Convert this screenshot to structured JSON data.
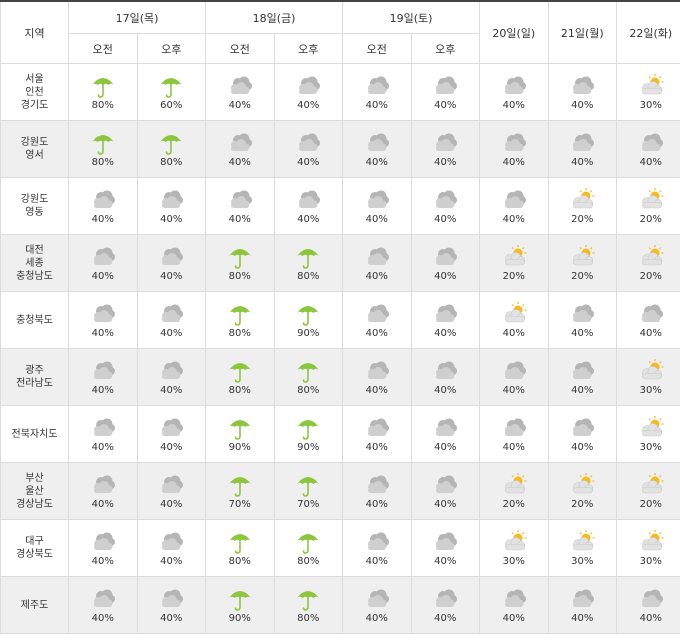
{
  "header": {
    "region_label": "지역",
    "days": [
      {
        "label": "17일(목)",
        "split": true
      },
      {
        "label": "18일(금)",
        "split": true
      },
      {
        "label": "19일(토)",
        "split": true
      },
      {
        "label": "20일(일)",
        "split": false
      },
      {
        "label": "21일(월)",
        "split": false
      },
      {
        "label": "22일(화)",
        "split": false
      }
    ],
    "am_label": "오전",
    "pm_label": "오후"
  },
  "icons": {
    "rain": "umbrella-icon",
    "cloudy": "cloudy-icon",
    "partly": "partly-cloudy-icon"
  },
  "colors": {
    "umbrella": "#8cc63f",
    "cloud": "#b5b5b5",
    "sun": "#f5b921",
    "row_shade": "#efefef",
    "border": "#dcdcdc"
  },
  "rows": [
    {
      "region": [
        "서울",
        "인천",
        "경기도"
      ],
      "cells": [
        {
          "icon": "rain",
          "pct": "80%"
        },
        {
          "icon": "rain",
          "pct": "60%"
        },
        {
          "icon": "cloudy",
          "pct": "40%"
        },
        {
          "icon": "cloudy",
          "pct": "40%"
        },
        {
          "icon": "cloudy",
          "pct": "40%"
        },
        {
          "icon": "cloudy",
          "pct": "40%"
        },
        {
          "icon": "cloudy",
          "pct": "40%"
        },
        {
          "icon": "cloudy",
          "pct": "40%"
        },
        {
          "icon": "partly",
          "pct": "30%"
        }
      ]
    },
    {
      "region": [
        "강원도",
        "영서"
      ],
      "cells": [
        {
          "icon": "rain",
          "pct": "80%"
        },
        {
          "icon": "rain",
          "pct": "80%"
        },
        {
          "icon": "cloudy",
          "pct": "40%"
        },
        {
          "icon": "cloudy",
          "pct": "40%"
        },
        {
          "icon": "cloudy",
          "pct": "40%"
        },
        {
          "icon": "cloudy",
          "pct": "40%"
        },
        {
          "icon": "cloudy",
          "pct": "40%"
        },
        {
          "icon": "cloudy",
          "pct": "40%"
        },
        {
          "icon": "cloudy",
          "pct": "40%"
        }
      ]
    },
    {
      "region": [
        "강원도",
        "영동"
      ],
      "cells": [
        {
          "icon": "cloudy",
          "pct": "40%"
        },
        {
          "icon": "cloudy",
          "pct": "40%"
        },
        {
          "icon": "cloudy",
          "pct": "40%"
        },
        {
          "icon": "cloudy",
          "pct": "40%"
        },
        {
          "icon": "cloudy",
          "pct": "40%"
        },
        {
          "icon": "cloudy",
          "pct": "40%"
        },
        {
          "icon": "cloudy",
          "pct": "40%"
        },
        {
          "icon": "partly",
          "pct": "20%"
        },
        {
          "icon": "partly",
          "pct": "20%"
        }
      ]
    },
    {
      "region": [
        "대전",
        "세종",
        "충청남도"
      ],
      "cells": [
        {
          "icon": "cloudy",
          "pct": "40%"
        },
        {
          "icon": "cloudy",
          "pct": "40%"
        },
        {
          "icon": "rain",
          "pct": "80%"
        },
        {
          "icon": "rain",
          "pct": "80%"
        },
        {
          "icon": "cloudy",
          "pct": "40%"
        },
        {
          "icon": "cloudy",
          "pct": "40%"
        },
        {
          "icon": "partly",
          "pct": "20%"
        },
        {
          "icon": "partly",
          "pct": "20%"
        },
        {
          "icon": "partly",
          "pct": "20%"
        }
      ]
    },
    {
      "region": [
        "충청북도"
      ],
      "cells": [
        {
          "icon": "cloudy",
          "pct": "40%"
        },
        {
          "icon": "cloudy",
          "pct": "40%"
        },
        {
          "icon": "rain",
          "pct": "80%"
        },
        {
          "icon": "rain",
          "pct": "90%"
        },
        {
          "icon": "cloudy",
          "pct": "40%"
        },
        {
          "icon": "cloudy",
          "pct": "40%"
        },
        {
          "icon": "partly",
          "pct": "40%"
        },
        {
          "icon": "cloudy",
          "pct": "40%"
        },
        {
          "icon": "cloudy",
          "pct": "40%"
        }
      ]
    },
    {
      "region": [
        "광주",
        "전라남도"
      ],
      "cells": [
        {
          "icon": "cloudy",
          "pct": "40%"
        },
        {
          "icon": "cloudy",
          "pct": "40%"
        },
        {
          "icon": "rain",
          "pct": "80%"
        },
        {
          "icon": "rain",
          "pct": "80%"
        },
        {
          "icon": "cloudy",
          "pct": "40%"
        },
        {
          "icon": "cloudy",
          "pct": "40%"
        },
        {
          "icon": "cloudy",
          "pct": "40%"
        },
        {
          "icon": "cloudy",
          "pct": "40%"
        },
        {
          "icon": "partly",
          "pct": "30%"
        }
      ]
    },
    {
      "region": [
        "전북자치도"
      ],
      "cells": [
        {
          "icon": "cloudy",
          "pct": "40%"
        },
        {
          "icon": "cloudy",
          "pct": "40%"
        },
        {
          "icon": "rain",
          "pct": "90%"
        },
        {
          "icon": "rain",
          "pct": "90%"
        },
        {
          "icon": "cloudy",
          "pct": "40%"
        },
        {
          "icon": "cloudy",
          "pct": "40%"
        },
        {
          "icon": "cloudy",
          "pct": "40%"
        },
        {
          "icon": "cloudy",
          "pct": "40%"
        },
        {
          "icon": "partly",
          "pct": "30%"
        }
      ]
    },
    {
      "region": [
        "부산",
        "울산",
        "경상남도"
      ],
      "cells": [
        {
          "icon": "cloudy",
          "pct": "40%"
        },
        {
          "icon": "cloudy",
          "pct": "40%"
        },
        {
          "icon": "rain",
          "pct": "70%"
        },
        {
          "icon": "rain",
          "pct": "70%"
        },
        {
          "icon": "cloudy",
          "pct": "40%"
        },
        {
          "icon": "cloudy",
          "pct": "40%"
        },
        {
          "icon": "partly",
          "pct": "20%"
        },
        {
          "icon": "partly",
          "pct": "20%"
        },
        {
          "icon": "partly",
          "pct": "20%"
        }
      ]
    },
    {
      "region": [
        "대구",
        "경상북도"
      ],
      "cells": [
        {
          "icon": "cloudy",
          "pct": "40%"
        },
        {
          "icon": "cloudy",
          "pct": "40%"
        },
        {
          "icon": "rain",
          "pct": "80%"
        },
        {
          "icon": "rain",
          "pct": "80%"
        },
        {
          "icon": "cloudy",
          "pct": "40%"
        },
        {
          "icon": "cloudy",
          "pct": "40%"
        },
        {
          "icon": "partly",
          "pct": "30%"
        },
        {
          "icon": "partly",
          "pct": "30%"
        },
        {
          "icon": "partly",
          "pct": "30%"
        }
      ]
    },
    {
      "region": [
        "제주도"
      ],
      "cells": [
        {
          "icon": "cloudy",
          "pct": "40%"
        },
        {
          "icon": "cloudy",
          "pct": "40%"
        },
        {
          "icon": "rain",
          "pct": "90%"
        },
        {
          "icon": "rain",
          "pct": "80%"
        },
        {
          "icon": "cloudy",
          "pct": "40%"
        },
        {
          "icon": "cloudy",
          "pct": "40%"
        },
        {
          "icon": "cloudy",
          "pct": "40%"
        },
        {
          "icon": "cloudy",
          "pct": "40%"
        },
        {
          "icon": "cloudy",
          "pct": "40%"
        }
      ]
    }
  ]
}
